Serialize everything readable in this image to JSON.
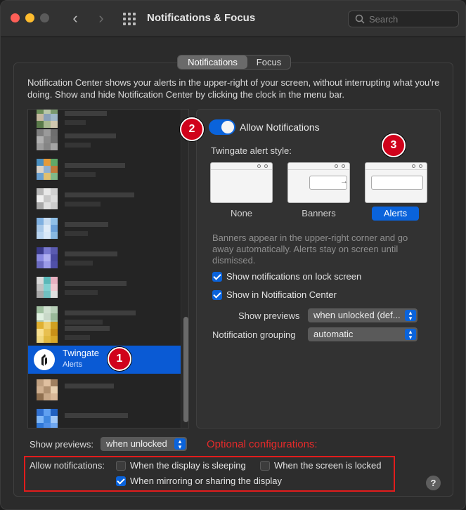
{
  "window": {
    "title": "Notifications & Focus",
    "search_placeholder": "Search"
  },
  "tabs": [
    {
      "label": "Notifications",
      "active": true
    },
    {
      "label": "Focus",
      "active": false
    }
  ],
  "intro_text": "Notification Center shows your alerts in the upper-right of your screen, without interrupting what you're doing. Show and hide Notification Center by clicking the clock in the menu bar.",
  "app_list": {
    "selected": {
      "name": "Twingate",
      "subtitle": "Alerts"
    }
  },
  "detail": {
    "allow_notifications_label": "Allow Notifications",
    "allow_notifications_on": true,
    "alert_style_label": "Twingate alert style:",
    "styles": [
      {
        "label": "None",
        "selected": false
      },
      {
        "label": "Banners",
        "selected": false
      },
      {
        "label": "Alerts",
        "selected": true
      }
    ],
    "description": "Banners appear in the upper-right corner and go away automatically. Alerts stay on screen until dismissed.",
    "lock_screen_label": "Show notifications on lock screen",
    "notification_center_label": "Show in Notification Center",
    "show_previews_label": "Show previews",
    "show_previews_value": "when unlocked (def...",
    "grouping_label": "Notification grouping",
    "grouping_value": "automatic"
  },
  "bottom": {
    "show_previews_label": "Show previews:",
    "show_previews_value": "when unlocked",
    "optional_text": "Optional configurations:",
    "allow_label": "Allow notifications:",
    "display_sleeping_label": "When the display is sleeping",
    "screen_locked_label": "When the screen is locked",
    "mirroring_label": "When mirroring or sharing the display",
    "help_label": "?"
  },
  "badges": [
    "1",
    "2",
    "3"
  ],
  "colors": {
    "accent": "#0a63db",
    "annotation": "#d0021b"
  }
}
